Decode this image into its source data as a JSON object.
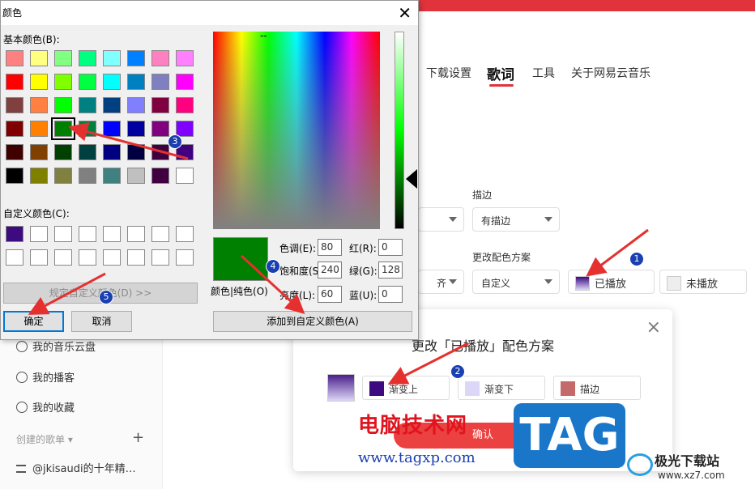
{
  "app": {
    "nav_tabs": [
      {
        "label": "下载设置"
      },
      {
        "label": "歌词"
      },
      {
        "label": "工具"
      },
      {
        "label": "关于网易云音乐"
      }
    ],
    "stroke_label": "描边",
    "stroke_value": "有描边",
    "left_dd_tail": "齐",
    "scheme_label": "更改配色方案",
    "scheme_value": "自定义",
    "played_label": "已播放",
    "unplayed_label": "未播放",
    "sidebar": [
      {
        "label": "我的音乐云盘"
      },
      {
        "label": "我的播客"
      },
      {
        "label": "我的收藏"
      }
    ],
    "created_playlists": "创建的歌单",
    "plus": "+",
    "playlist_item": "@jkisaudi的十年精…"
  },
  "scheme_dialog": {
    "title": "更改「已播放」配色方案",
    "close": "×",
    "buttons": [
      {
        "label": "渐变上",
        "color": "#3d0a80"
      },
      {
        "label": "渐变下",
        "color": "#dcd6f7"
      },
      {
        "label": "描边",
        "color": "#c46a6a"
      }
    ],
    "ok_label": "确认"
  },
  "color_dialog": {
    "title": "颜色",
    "close": "✕",
    "basic_label": "基本颜色(B):",
    "custom_label": "自定义颜色(C):",
    "basic_colors": [
      "#ff8080",
      "#ffff80",
      "#80ff80",
      "#00ff80",
      "#80ffff",
      "#0080ff",
      "#ff80c0",
      "#ff80ff",
      "#ff0000",
      "#ffff00",
      "#80ff00",
      "#00ff40",
      "#00ffff",
      "#0080c0",
      "#8080c0",
      "#ff00ff",
      "#804040",
      "#ff8040",
      "#00ff00",
      "#008080",
      "#004080",
      "#8080ff",
      "#800040",
      "#ff0080",
      "#800000",
      "#ff8000",
      "#008000",
      "#008040",
      "#0000ff",
      "#0000a0",
      "#800080",
      "#8000ff",
      "#400000",
      "#804000",
      "#004000",
      "#004040",
      "#000080",
      "#000040",
      "#400040",
      "#400080",
      "#000000",
      "#808000",
      "#808040",
      "#808080",
      "#408080",
      "#c0c0c0",
      "#400040",
      "#ffffff"
    ],
    "selected_index": 26,
    "custom_colors": [
      "#3d0a80",
      "#ffffff",
      "#ffffff",
      "#ffffff",
      "#ffffff",
      "#ffffff",
      "#ffffff",
      "#ffffff",
      "#ffffff",
      "#ffffff",
      "#ffffff",
      "#ffffff",
      "#ffffff",
      "#ffffff",
      "#ffffff",
      "#ffffff"
    ],
    "define_custom_label": "规定自定义颜色(D) >>",
    "ok_label": "确定",
    "cancel_label": "取消",
    "preview_color": "#008000",
    "preview_label": "颜色|纯色(O)",
    "hue_label": "色调(E):",
    "hue": "80",
    "sat_label": "饱和度(S):",
    "sat": "240",
    "lum_label": "亮度(L):",
    "lum": "60",
    "red_label": "红(R):",
    "red": "0",
    "green_label": "绿(G):",
    "green": "128",
    "blue_label": "蓝(U):",
    "blue": "0",
    "add_custom_label": "添加到自定义颜色(A)"
  },
  "annotations": [
    "1",
    "2",
    "3",
    "4",
    "5"
  ],
  "watermark": {
    "cn": "电脑技术网",
    "url": "www.tagxp.com",
    "tag": "TAG",
    "site": "极光下载站",
    "site_url": "www.xz7.com"
  }
}
